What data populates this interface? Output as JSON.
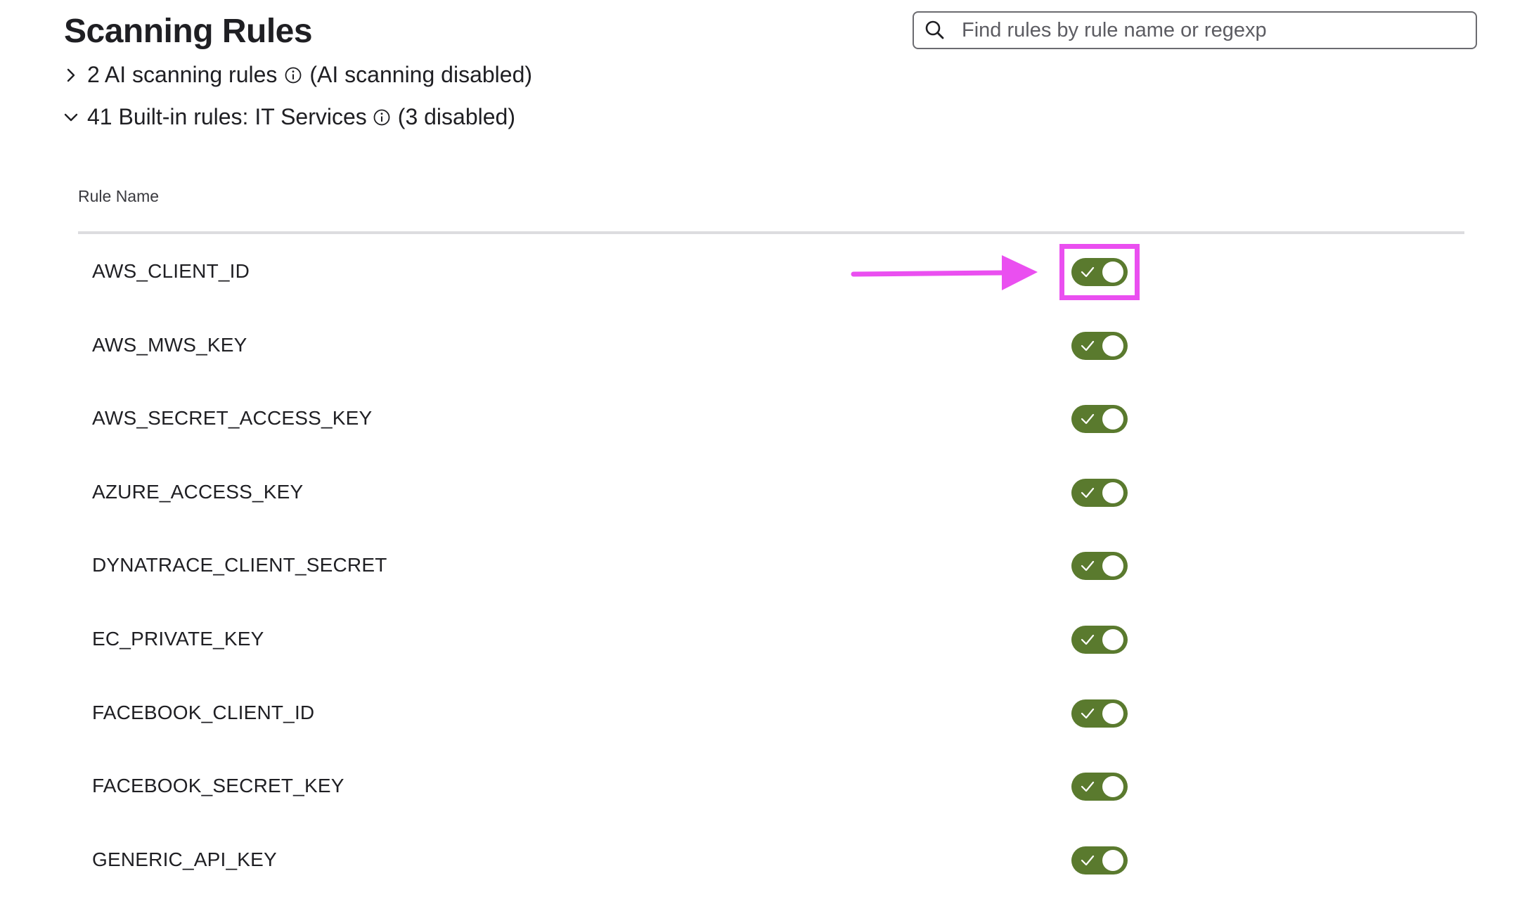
{
  "page": {
    "title": "Scanning Rules"
  },
  "search": {
    "placeholder": "Find rules by rule name or regexp",
    "icon": "search-icon"
  },
  "sections": [
    {
      "count_label": "2 AI scanning rules",
      "status": "(AI scanning disabled)",
      "expanded": false,
      "chevron_icon": "chevron-right-icon",
      "info_icon": "info-icon"
    },
    {
      "count_label": "41 Built-in rules: IT Services",
      "status": "(3 disabled)",
      "expanded": true,
      "chevron_icon": "chevron-down-icon",
      "info_icon": "info-icon"
    }
  ],
  "table": {
    "column_header": "Rule Name",
    "rows": [
      {
        "name": "AWS_CLIENT_ID",
        "enabled": true,
        "highlighted": true
      },
      {
        "name": "AWS_MWS_KEY",
        "enabled": true
      },
      {
        "name": "AWS_SECRET_ACCESS_KEY",
        "enabled": true
      },
      {
        "name": "AZURE_ACCESS_KEY",
        "enabled": true
      },
      {
        "name": "DYNATRACE_CLIENT_SECRET",
        "enabled": true
      },
      {
        "name": "EC_PRIVATE_KEY",
        "enabled": true
      },
      {
        "name": "FACEBOOK_CLIENT_ID",
        "enabled": true
      },
      {
        "name": "FACEBOOK_SECRET_KEY",
        "enabled": true
      },
      {
        "name": "GENERIC_API_KEY",
        "enabled": true
      }
    ]
  },
  "colors": {
    "toggle_on": "#5a7a2e",
    "annotation": "#ea4ff0"
  }
}
